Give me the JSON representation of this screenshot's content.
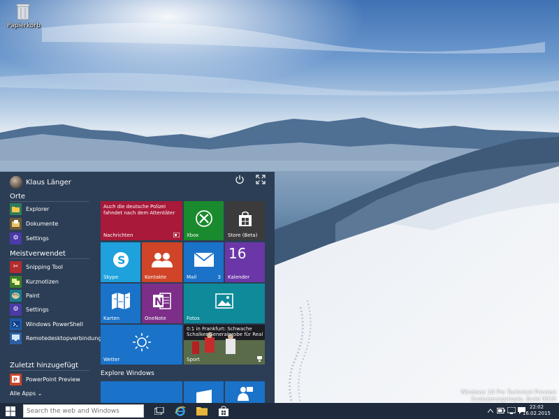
{
  "desktop": {
    "icons": [
      {
        "label": "Papierkorb",
        "icon": "recycle-bin-icon"
      }
    ],
    "watermark": {
      "line1": "Windows 10 Pro Technical Preview",
      "line2": "Evaluierungskopie. Build 9926"
    }
  },
  "start_menu": {
    "user_name": "Klaus Länger",
    "sections": {
      "places": {
        "title": "Orte",
        "items": [
          {
            "label": "Explorer",
            "icon": "folder-icon",
            "color": "#2e7d5b"
          },
          {
            "label": "Dokumente",
            "icon": "documents-icon",
            "color": "#6b5a3a"
          },
          {
            "label": "Settings",
            "icon": "gear-icon",
            "color": "#4b3aa8"
          }
        ]
      },
      "most_used": {
        "title": "Meistverwendet",
        "items": [
          {
            "label": "Snipping Tool",
            "icon": "scissors-icon",
            "color": "#b22d2d"
          },
          {
            "label": "Kurznotizen",
            "icon": "sticky-notes-icon",
            "color": "#3f7e2c"
          },
          {
            "label": "Paint",
            "icon": "palette-icon",
            "color": "#1d7a8a"
          },
          {
            "label": "Settings",
            "icon": "gear-icon",
            "color": "#4b3aa8"
          },
          {
            "label": "Windows PowerShell",
            "icon": "powershell-icon",
            "color": "#1e5aa8"
          },
          {
            "label": "Remotedesktopverbindung",
            "icon": "remote-desktop-icon",
            "color": "#2b5fa5"
          }
        ]
      },
      "recently_added": {
        "title": "Zuletzt hinzugefügt",
        "items": [
          {
            "label": "PowerPoint Preview",
            "icon": "powerpoint-icon",
            "color": "#c8472a"
          }
        ]
      }
    },
    "all_apps": "Alle Apps ⌄",
    "explore_title": "Explore Windows",
    "tiles": {
      "news": {
        "headline": "Auch die deutsche Polizei fahndet nach dem Attentäter",
        "label": "Nachrichten",
        "color": "#a8193a"
      },
      "xbox": {
        "label": "Xbox",
        "color": "#1a8a2e"
      },
      "store": {
        "label": "Store (Beta)",
        "color": "#3b3b3b"
      },
      "skype": {
        "label": "Skype",
        "color": "#1ea1dc"
      },
      "contacts": {
        "label": "Kontakte",
        "color": "#d04527"
      },
      "mail": {
        "label": "Mail",
        "count": "3",
        "color": "#1a72c9"
      },
      "calendar": {
        "label": "Kalender",
        "day": "16",
        "color": "#6b37a8"
      },
      "maps": {
        "label": "Karten",
        "color": "#1a72c9"
      },
      "onenote": {
        "label": "OneNote",
        "color": "#7c2e88"
      },
      "photos": {
        "label": "Fotos",
        "color": "#0e8a9a"
      },
      "sport": {
        "headline": "0:1 in Frankfurt: Schwache Schalker Generalprobe für Real",
        "label": "Sport"
      },
      "weather": {
        "label": "Wetter",
        "color": "#1a72c9"
      }
    }
  },
  "taskbar": {
    "search_placeholder": "Search the web and Windows",
    "time": "22:02",
    "date": "16.02.2015"
  },
  "colors": {
    "accent": "#1a72c9",
    "start_bg": "#2c3e55",
    "taskbar_bg": "#1f2b3c"
  }
}
